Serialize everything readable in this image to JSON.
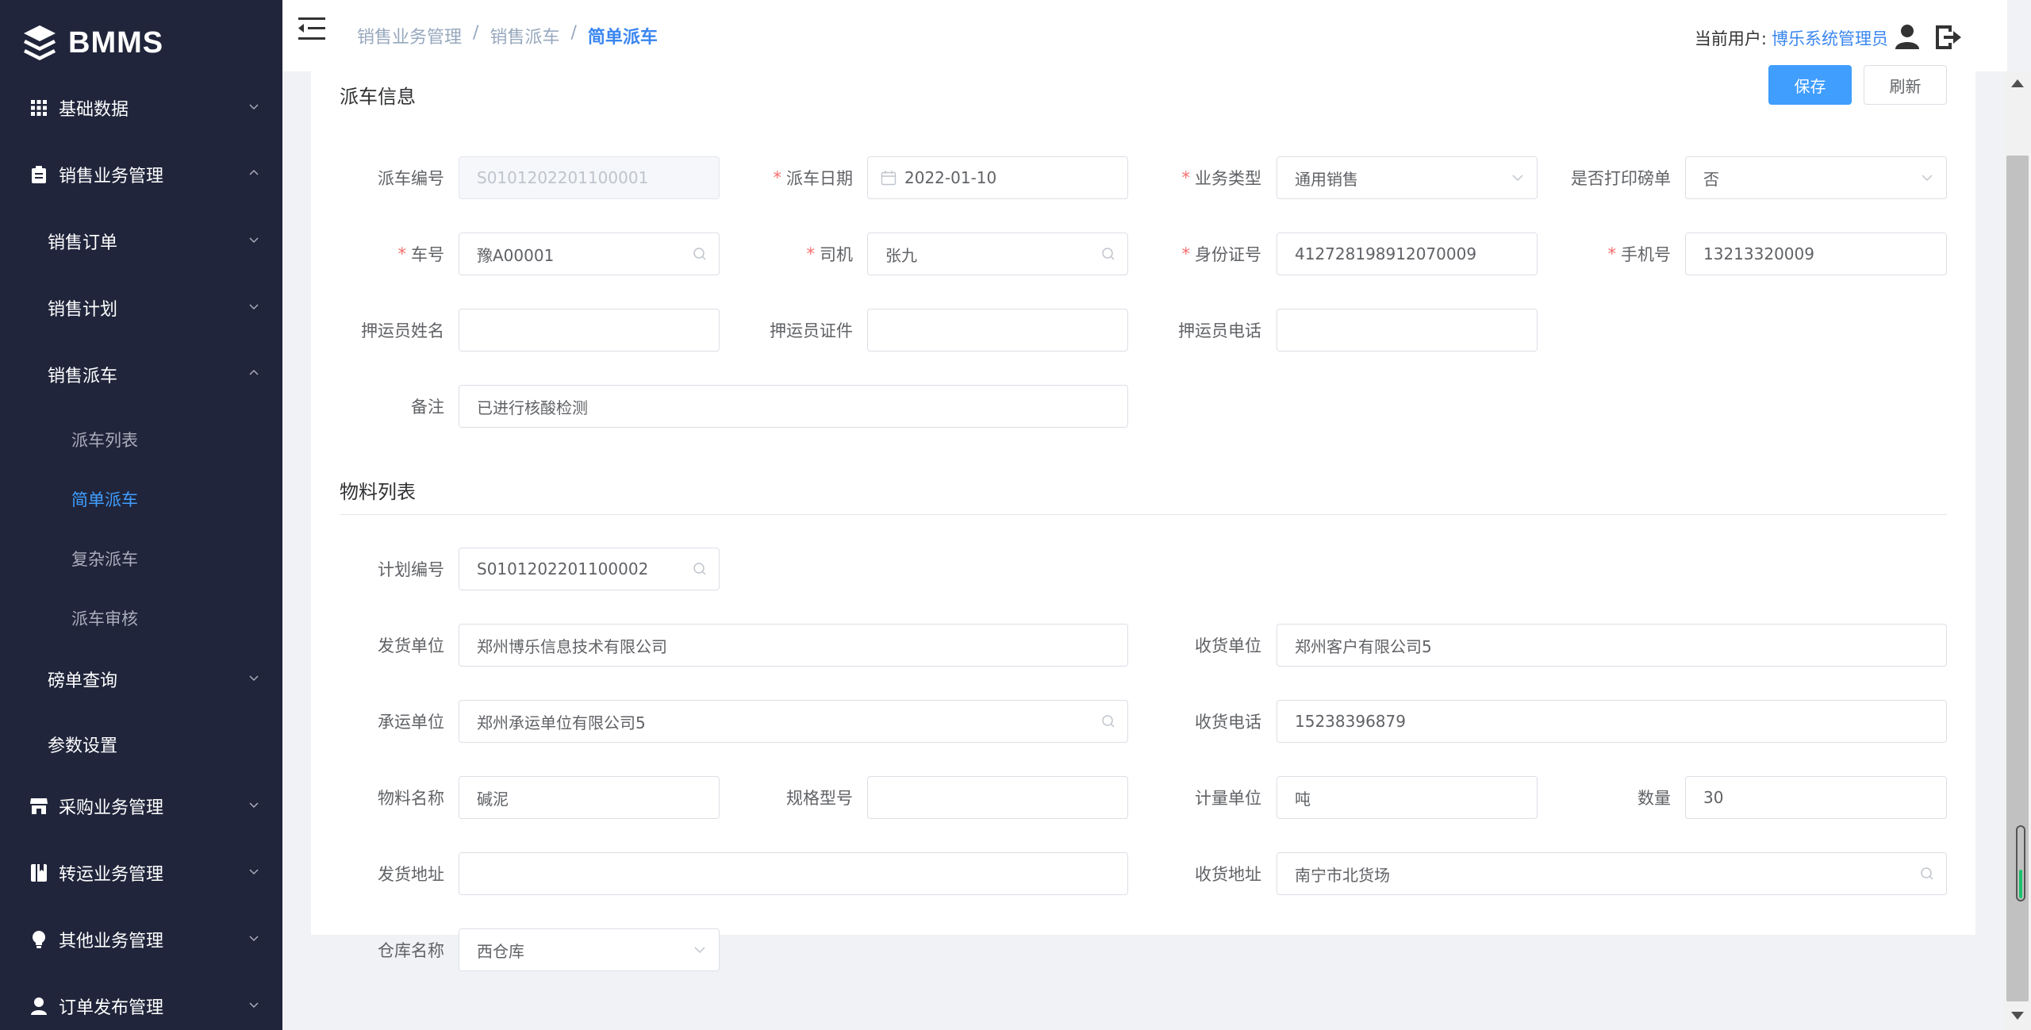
{
  "app": {
    "name": "BMMS"
  },
  "sidebar": {
    "items": [
      {
        "label": "基础数据"
      },
      {
        "label": "销售业务管理"
      },
      {
        "label": "销售订单"
      },
      {
        "label": "销售计划"
      },
      {
        "label": "销售派车"
      },
      {
        "label": "派车列表"
      },
      {
        "label": "简单派车"
      },
      {
        "label": "复杂派车"
      },
      {
        "label": "派车审核"
      },
      {
        "label": "磅单查询"
      },
      {
        "label": "参数设置"
      },
      {
        "label": "采购业务管理"
      },
      {
        "label": "转运业务管理"
      },
      {
        "label": "其他业务管理"
      },
      {
        "label": "订单发布管理"
      }
    ]
  },
  "header": {
    "breadcrumb": [
      "销售业务管理",
      "销售派车",
      "简单派车"
    ],
    "user_prefix": "当前用户:",
    "user_name": "博乐系统管理员"
  },
  "dispatch": {
    "title": "派车信息",
    "save_label": "保存",
    "refresh_label": "刷新",
    "fields": {
      "dispatch_no": {
        "label": "派车编号",
        "value": "S0101202201100001"
      },
      "dispatch_date": {
        "label": "派车日期",
        "value": "2022-01-10"
      },
      "business_type": {
        "label": "业务类型",
        "value": "通用销售"
      },
      "print_ticket": {
        "label": "是否打印磅单",
        "value": "否"
      },
      "plate_no": {
        "label": "车号",
        "value": "豫A00001"
      },
      "driver": {
        "label": "司机",
        "value": "张九"
      },
      "id_no": {
        "label": "身份证号",
        "value": "412728198912070009"
      },
      "phone": {
        "label": "手机号",
        "value": "13213320009"
      },
      "escort_name": {
        "label": "押运员姓名",
        "value": ""
      },
      "escort_cert": {
        "label": "押运员证件",
        "value": ""
      },
      "escort_phone": {
        "label": "押运员电话",
        "value": ""
      },
      "remark": {
        "label": "备注",
        "value": "已进行核酸检测"
      }
    }
  },
  "materials": {
    "title": "物料列表",
    "fields": {
      "plan_no": {
        "label": "计划编号",
        "value": "S0101202201100002"
      },
      "shipper": {
        "label": "发货单位",
        "value": "郑州博乐信息技术有限公司"
      },
      "receiver": {
        "label": "收货单位",
        "value": "郑州客户有限公司5"
      },
      "carrier": {
        "label": "承运单位",
        "value": "郑州承运单位有限公司5"
      },
      "receiver_phone": {
        "label": "收货电话",
        "value": "15238396879"
      },
      "material_name": {
        "label": "物料名称",
        "value": "碱泥"
      },
      "spec": {
        "label": "规格型号",
        "value": ""
      },
      "unit": {
        "label": "计量单位",
        "value": "吨"
      },
      "quantity": {
        "label": "数量",
        "value": "30"
      },
      "ship_address": {
        "label": "发货地址",
        "value": ""
      },
      "receive_address": {
        "label": "收货地址",
        "value": "南宁市北货场"
      },
      "warehouse": {
        "label": "仓库名称",
        "value": "西仓库"
      }
    }
  },
  "colors": {
    "sidebar_bg": "#20253b",
    "accent": "#409eff",
    "required": "#f56c6c"
  }
}
